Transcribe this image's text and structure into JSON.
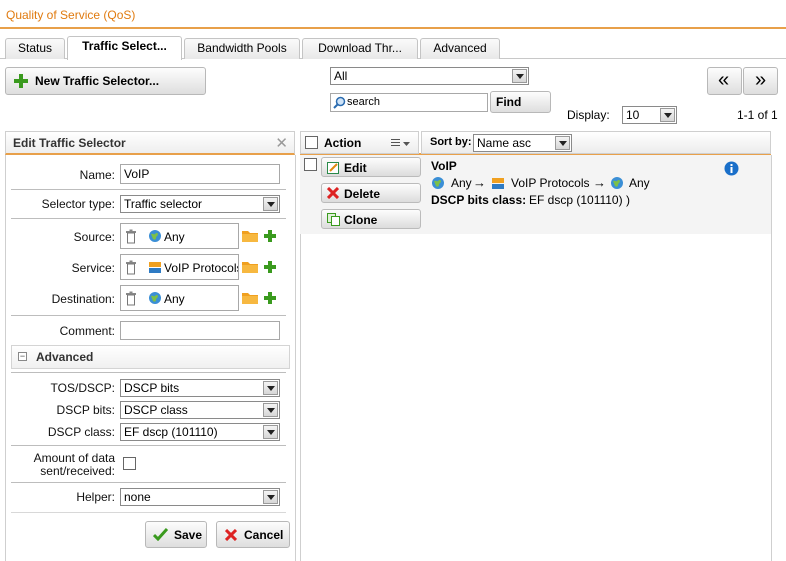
{
  "app": {
    "title": "Quality of Service (QoS)"
  },
  "tabs": [
    {
      "label": "Status"
    },
    {
      "label": "Traffic Select..."
    },
    {
      "label": "Bandwidth Pools"
    },
    {
      "label": "Download Thr..."
    },
    {
      "label": "Advanced"
    }
  ],
  "toolbar": {
    "new_button": "New Traffic Selector...",
    "filter_value": "All",
    "search_placeholder": "search",
    "find_button": "Find",
    "display_label": "Display:",
    "display_value": "10",
    "range_text": "1-1 of 1",
    "prev_label": "«",
    "next_label": "»"
  },
  "editor": {
    "title": "Edit Traffic Selector",
    "name_label": "Name:",
    "name_value": "VoIP",
    "selector_type_label": "Selector type:",
    "selector_type_value": "Traffic selector",
    "source_label": "Source:",
    "source_value": "Any",
    "service_label": "Service:",
    "service_value": "VoIP Protocols",
    "destination_label": "Destination:",
    "destination_value": "Any",
    "comment_label": "Comment:",
    "comment_value": "",
    "advanced_title": "Advanced",
    "tos_label": "TOS/DSCP:",
    "tos_value": "DSCP bits",
    "dscp_bits_label": "DSCP bits:",
    "dscp_bits_value": "DSCP class",
    "dscp_class_label": "DSCP class:",
    "dscp_class_value": "EF dscp (101110)",
    "amount_label_1": "Amount of data",
    "amount_label_2": "sent/received:",
    "helper_label": "Helper:",
    "helper_value": "none",
    "save_button": "Save",
    "cancel_button": "Cancel"
  },
  "list": {
    "action_header": "Action",
    "sortby_label": "Sort by:",
    "sortby_value": "Name asc",
    "rows": [
      {
        "name": "VoIP",
        "source": "Any",
        "service": "VoIP Protocols",
        "destination": "Any",
        "dscp_label": "DSCP bits class:",
        "dscp_value": "EF dscp (101110) )",
        "edit_label": "Edit",
        "delete_label": "Delete",
        "clone_label": "Clone"
      }
    ]
  },
  "colors": {
    "accent": "#e8a04a",
    "title": "#e07b10",
    "info": "#1a6fc9"
  }
}
